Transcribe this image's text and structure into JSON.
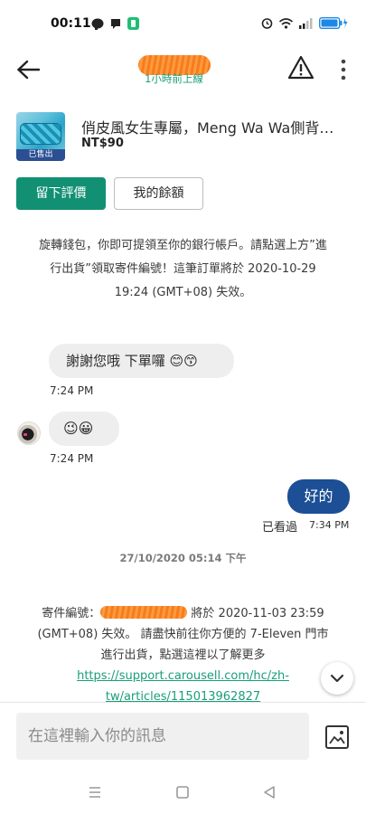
{
  "status_bar": {
    "time": "00:11"
  },
  "header": {
    "last_online": "1小時前上線"
  },
  "listing": {
    "title": "俏皮風女生專屬，Meng Wa Wa側背…",
    "price": "NT$90",
    "sold_badge": "已售出"
  },
  "actions": {
    "review_label": "留下評價",
    "balance_label": "我的餘額"
  },
  "system_message_1": "旋轉錢包，你即可提領至你的銀行帳戶。請點選上方”進行出貨”領取寄件編號！這筆訂單將於 2020-10-29 19:24 (GMT+08) 失效。",
  "messages": [
    {
      "text": "謝謝您哦 下單囉 😊😙",
      "time": "7:24 PM"
    },
    {
      "text": "😉😀",
      "time": "7:24 PM"
    },
    {
      "text": "好的",
      "status": "已看過",
      "time": "7:34 PM"
    }
  ],
  "date_separator": "27/10/2020 05:14 下午",
  "system_message_2": {
    "prefix": "寄件編號：",
    "body": " 將於 2020-11-03 23:59 (GMT+08) 失效。 請盡快前往你方便的 7-Eleven 門市進行出貨，點選這裡以了解更多 ",
    "link": "https://support.carousell.com/hc/zh-tw/articles/115013962827"
  },
  "composer": {
    "placeholder": "在這裡輸入你的訊息"
  },
  "colors": {
    "accent_green": "#129073",
    "link_green": "#199e7a",
    "outgoing_bubble": "#1c4f95",
    "sold_badge": "#2c4f93"
  },
  "icons": [
    "back-arrow-icon",
    "warning-icon",
    "more-vertical-icon",
    "image-icon",
    "chevron-down-icon"
  ]
}
